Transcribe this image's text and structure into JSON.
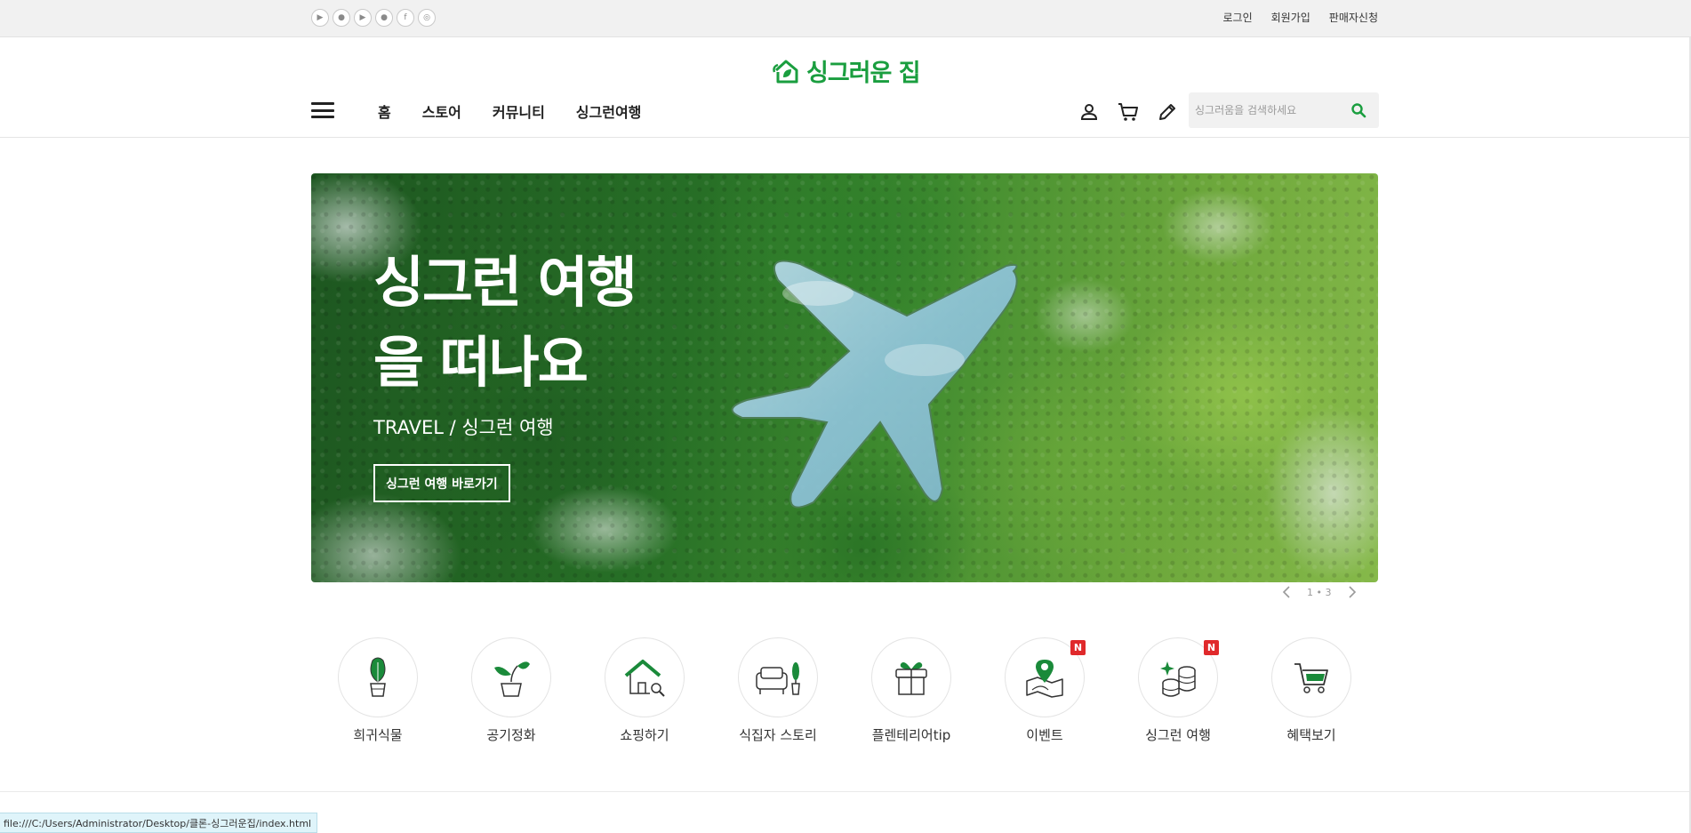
{
  "topbar": {
    "social_icons": [
      "google-play-icon",
      "apple-icon",
      "youtube-icon",
      "kakao-icon",
      "facebook-icon",
      "instagram-icon"
    ],
    "links": {
      "login": "로그인",
      "signup": "회원가입",
      "seller": "판매자신청"
    }
  },
  "header": {
    "logo_text": "싱그러운 집",
    "nav": [
      "홈",
      "스토어",
      "커뮤니티",
      "싱그런여행"
    ],
    "icons": [
      "user-icon",
      "cart-icon",
      "pencil-icon"
    ],
    "search_placeholder": "싱그러움을 검색하세요"
  },
  "hero": {
    "title_line1": "싱그런 여행",
    "title_line2": "을 떠나요",
    "subtitle": "TRAVEL / 싱그런 여행",
    "button_label": "싱그런 여행 바로가기",
    "pager": {
      "current": "1",
      "separator": "•",
      "total": "3"
    }
  },
  "categories": [
    {
      "label": "희귀식물",
      "icon": "plant-pot-icon",
      "badge": ""
    },
    {
      "label": "공기정화",
      "icon": "sprout-icon",
      "badge": ""
    },
    {
      "label": "쇼핑하기",
      "icon": "house-search-icon",
      "badge": ""
    },
    {
      "label": "식집자 스토리",
      "icon": "sofa-plant-icon",
      "badge": ""
    },
    {
      "label": "플렌테리어tip",
      "icon": "gift-box-icon",
      "badge": ""
    },
    {
      "label": "이벤트",
      "icon": "map-pin-icon",
      "badge": "N"
    },
    {
      "label": "싱그런 여행",
      "icon": "coins-icon",
      "badge": "N"
    },
    {
      "label": "혜택보기",
      "icon": "shopping-cart-icon",
      "badge": ""
    }
  ],
  "status_bar": "file:///C:/Users/Administrator/Desktop/클론-싱그러운집/index.html",
  "colors": {
    "brand_green": "#1a9e3f",
    "badge_red": "#e0292b",
    "topbar_bg": "#f1f1f1"
  }
}
